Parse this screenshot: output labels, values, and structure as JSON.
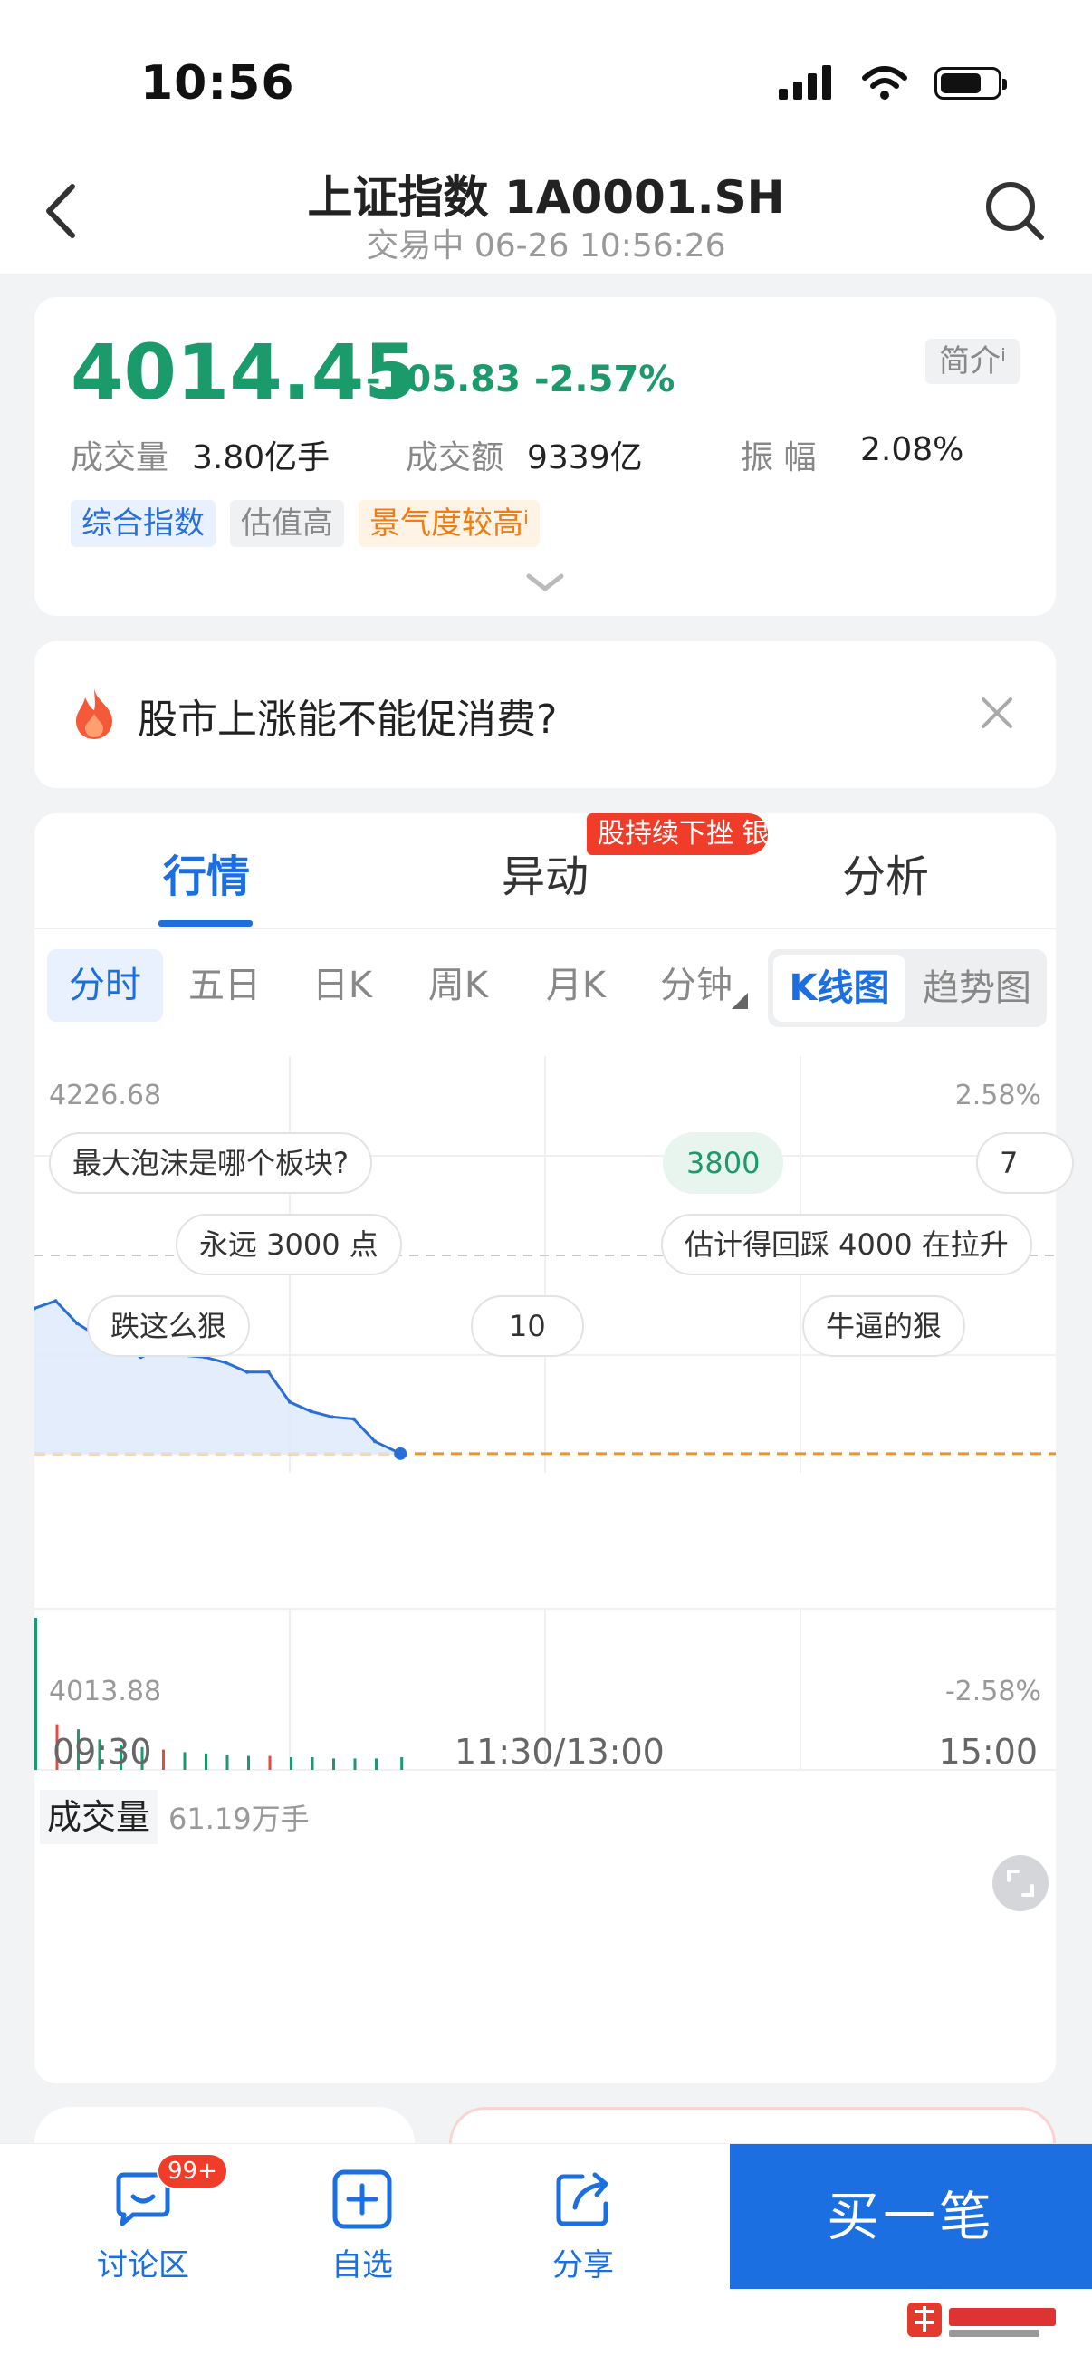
{
  "status": {
    "time": "10:56"
  },
  "header": {
    "title": "上证指数 1A0001.SH",
    "subtitle": "交易中 06-26 10:56:26"
  },
  "quote": {
    "price": "4014.45",
    "change": "-105.83",
    "change_pct": "-2.57%",
    "intro_label": "简介ⁱ",
    "volume_label": "成交量",
    "volume_value": "3.80亿手",
    "amount_label": "成交额",
    "amount_value": "9339亿",
    "amplitude_label": "振    幅",
    "amplitude_value": "2.08%",
    "tags": [
      "综合指数",
      "估值高",
      "景气度较高ⁱ"
    ]
  },
  "topic": {
    "text": "股市上涨能不能促消费?"
  },
  "tabs": [
    {
      "label": "行情",
      "active": true
    },
    {
      "label": "异动",
      "badge": "股持续下挫  银"
    },
    {
      "label": "分析"
    }
  ],
  "periods": [
    "分时",
    "五日",
    "日K",
    "周K",
    "月K",
    "分钟"
  ],
  "view_toggle": {
    "on": "K线图",
    "off": "趋势图"
  },
  "chart": {
    "y_high": "4226.68",
    "y_low": "4013.88",
    "pct_high": "2.58%",
    "pct_low": "-2.58%",
    "time_labels": [
      "09:30",
      "11:30/13:00",
      "15:00"
    ],
    "bubbles": [
      "最大泡沫是哪个板块?",
      "3800",
      "7",
      "永远 3000 点",
      "估计得回踩 4000 在拉升",
      "跌这么狠",
      "10",
      "牛逼的狠"
    ],
    "volume_label": "成交量",
    "volume_value": "61.19万手"
  },
  "chart_data": {
    "type": "line",
    "x": [
      "09:30",
      "09:35",
      "09:40",
      "09:45",
      "09:50",
      "09:55",
      "10:00",
      "10:05",
      "10:10",
      "10:15",
      "10:20",
      "10:25",
      "10:30",
      "10:35",
      "10:40",
      "10:45",
      "10:50",
      "10:56"
    ],
    "values": [
      4092,
      4096,
      4084,
      4077,
      4072,
      4066,
      4070,
      4067,
      4066,
      4063,
      4058,
      4058,
      4042,
      4037,
      4034,
      4033,
      4021,
      4014.45
    ],
    "volumes": [
      60,
      18,
      16,
      12,
      10,
      9,
      8,
      7,
      6.5,
      6,
      5.5,
      5.5,
      5,
      5,
      4.5,
      4.5,
      4.5,
      5
    ],
    "ylim": [
      4013.88,
      4226.68
    ],
    "xlim": [
      "09:30",
      "15:00"
    ],
    "grid": true
  },
  "bottom_bar": {
    "discuss": "讨论区",
    "discuss_badge": "99+",
    "watchlist": "自选",
    "share": "分享",
    "buy": "买一笔"
  }
}
